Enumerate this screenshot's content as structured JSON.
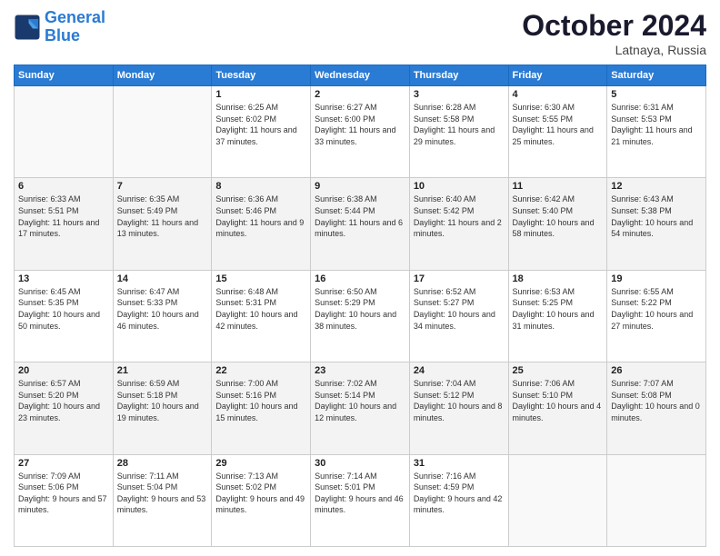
{
  "header": {
    "logo_line1": "General",
    "logo_line2": "Blue",
    "month": "October 2024",
    "location": "Latnaya, Russia"
  },
  "weekdays": [
    "Sunday",
    "Monday",
    "Tuesday",
    "Wednesday",
    "Thursday",
    "Friday",
    "Saturday"
  ],
  "rows": [
    [
      {
        "day": "",
        "sunrise": "",
        "sunset": "",
        "daylight": ""
      },
      {
        "day": "",
        "sunrise": "",
        "sunset": "",
        "daylight": ""
      },
      {
        "day": "1",
        "sunrise": "Sunrise: 6:25 AM",
        "sunset": "Sunset: 6:02 PM",
        "daylight": "Daylight: 11 hours and 37 minutes."
      },
      {
        "day": "2",
        "sunrise": "Sunrise: 6:27 AM",
        "sunset": "Sunset: 6:00 PM",
        "daylight": "Daylight: 11 hours and 33 minutes."
      },
      {
        "day": "3",
        "sunrise": "Sunrise: 6:28 AM",
        "sunset": "Sunset: 5:58 PM",
        "daylight": "Daylight: 11 hours and 29 minutes."
      },
      {
        "day": "4",
        "sunrise": "Sunrise: 6:30 AM",
        "sunset": "Sunset: 5:55 PM",
        "daylight": "Daylight: 11 hours and 25 minutes."
      },
      {
        "day": "5",
        "sunrise": "Sunrise: 6:31 AM",
        "sunset": "Sunset: 5:53 PM",
        "daylight": "Daylight: 11 hours and 21 minutes."
      }
    ],
    [
      {
        "day": "6",
        "sunrise": "Sunrise: 6:33 AM",
        "sunset": "Sunset: 5:51 PM",
        "daylight": "Daylight: 11 hours and 17 minutes."
      },
      {
        "day": "7",
        "sunrise": "Sunrise: 6:35 AM",
        "sunset": "Sunset: 5:49 PM",
        "daylight": "Daylight: 11 hours and 13 minutes."
      },
      {
        "day": "8",
        "sunrise": "Sunrise: 6:36 AM",
        "sunset": "Sunset: 5:46 PM",
        "daylight": "Daylight: 11 hours and 9 minutes."
      },
      {
        "day": "9",
        "sunrise": "Sunrise: 6:38 AM",
        "sunset": "Sunset: 5:44 PM",
        "daylight": "Daylight: 11 hours and 6 minutes."
      },
      {
        "day": "10",
        "sunrise": "Sunrise: 6:40 AM",
        "sunset": "Sunset: 5:42 PM",
        "daylight": "Daylight: 11 hours and 2 minutes."
      },
      {
        "day": "11",
        "sunrise": "Sunrise: 6:42 AM",
        "sunset": "Sunset: 5:40 PM",
        "daylight": "Daylight: 10 hours and 58 minutes."
      },
      {
        "day": "12",
        "sunrise": "Sunrise: 6:43 AM",
        "sunset": "Sunset: 5:38 PM",
        "daylight": "Daylight: 10 hours and 54 minutes."
      }
    ],
    [
      {
        "day": "13",
        "sunrise": "Sunrise: 6:45 AM",
        "sunset": "Sunset: 5:35 PM",
        "daylight": "Daylight: 10 hours and 50 minutes."
      },
      {
        "day": "14",
        "sunrise": "Sunrise: 6:47 AM",
        "sunset": "Sunset: 5:33 PM",
        "daylight": "Daylight: 10 hours and 46 minutes."
      },
      {
        "day": "15",
        "sunrise": "Sunrise: 6:48 AM",
        "sunset": "Sunset: 5:31 PM",
        "daylight": "Daylight: 10 hours and 42 minutes."
      },
      {
        "day": "16",
        "sunrise": "Sunrise: 6:50 AM",
        "sunset": "Sunset: 5:29 PM",
        "daylight": "Daylight: 10 hours and 38 minutes."
      },
      {
        "day": "17",
        "sunrise": "Sunrise: 6:52 AM",
        "sunset": "Sunset: 5:27 PM",
        "daylight": "Daylight: 10 hours and 34 minutes."
      },
      {
        "day": "18",
        "sunrise": "Sunrise: 6:53 AM",
        "sunset": "Sunset: 5:25 PM",
        "daylight": "Daylight: 10 hours and 31 minutes."
      },
      {
        "day": "19",
        "sunrise": "Sunrise: 6:55 AM",
        "sunset": "Sunset: 5:22 PM",
        "daylight": "Daylight: 10 hours and 27 minutes."
      }
    ],
    [
      {
        "day": "20",
        "sunrise": "Sunrise: 6:57 AM",
        "sunset": "Sunset: 5:20 PM",
        "daylight": "Daylight: 10 hours and 23 minutes."
      },
      {
        "day": "21",
        "sunrise": "Sunrise: 6:59 AM",
        "sunset": "Sunset: 5:18 PM",
        "daylight": "Daylight: 10 hours and 19 minutes."
      },
      {
        "day": "22",
        "sunrise": "Sunrise: 7:00 AM",
        "sunset": "Sunset: 5:16 PM",
        "daylight": "Daylight: 10 hours and 15 minutes."
      },
      {
        "day": "23",
        "sunrise": "Sunrise: 7:02 AM",
        "sunset": "Sunset: 5:14 PM",
        "daylight": "Daylight: 10 hours and 12 minutes."
      },
      {
        "day": "24",
        "sunrise": "Sunrise: 7:04 AM",
        "sunset": "Sunset: 5:12 PM",
        "daylight": "Daylight: 10 hours and 8 minutes."
      },
      {
        "day": "25",
        "sunrise": "Sunrise: 7:06 AM",
        "sunset": "Sunset: 5:10 PM",
        "daylight": "Daylight: 10 hours and 4 minutes."
      },
      {
        "day": "26",
        "sunrise": "Sunrise: 7:07 AM",
        "sunset": "Sunset: 5:08 PM",
        "daylight": "Daylight: 10 hours and 0 minutes."
      }
    ],
    [
      {
        "day": "27",
        "sunrise": "Sunrise: 7:09 AM",
        "sunset": "Sunset: 5:06 PM",
        "daylight": "Daylight: 9 hours and 57 minutes."
      },
      {
        "day": "28",
        "sunrise": "Sunrise: 7:11 AM",
        "sunset": "Sunset: 5:04 PM",
        "daylight": "Daylight: 9 hours and 53 minutes."
      },
      {
        "day": "29",
        "sunrise": "Sunrise: 7:13 AM",
        "sunset": "Sunset: 5:02 PM",
        "daylight": "Daylight: 9 hours and 49 minutes."
      },
      {
        "day": "30",
        "sunrise": "Sunrise: 7:14 AM",
        "sunset": "Sunset: 5:01 PM",
        "daylight": "Daylight: 9 hours and 46 minutes."
      },
      {
        "day": "31",
        "sunrise": "Sunrise: 7:16 AM",
        "sunset": "Sunset: 4:59 PM",
        "daylight": "Daylight: 9 hours and 42 minutes."
      },
      {
        "day": "",
        "sunrise": "",
        "sunset": "",
        "daylight": ""
      },
      {
        "day": "",
        "sunrise": "",
        "sunset": "",
        "daylight": ""
      }
    ]
  ]
}
